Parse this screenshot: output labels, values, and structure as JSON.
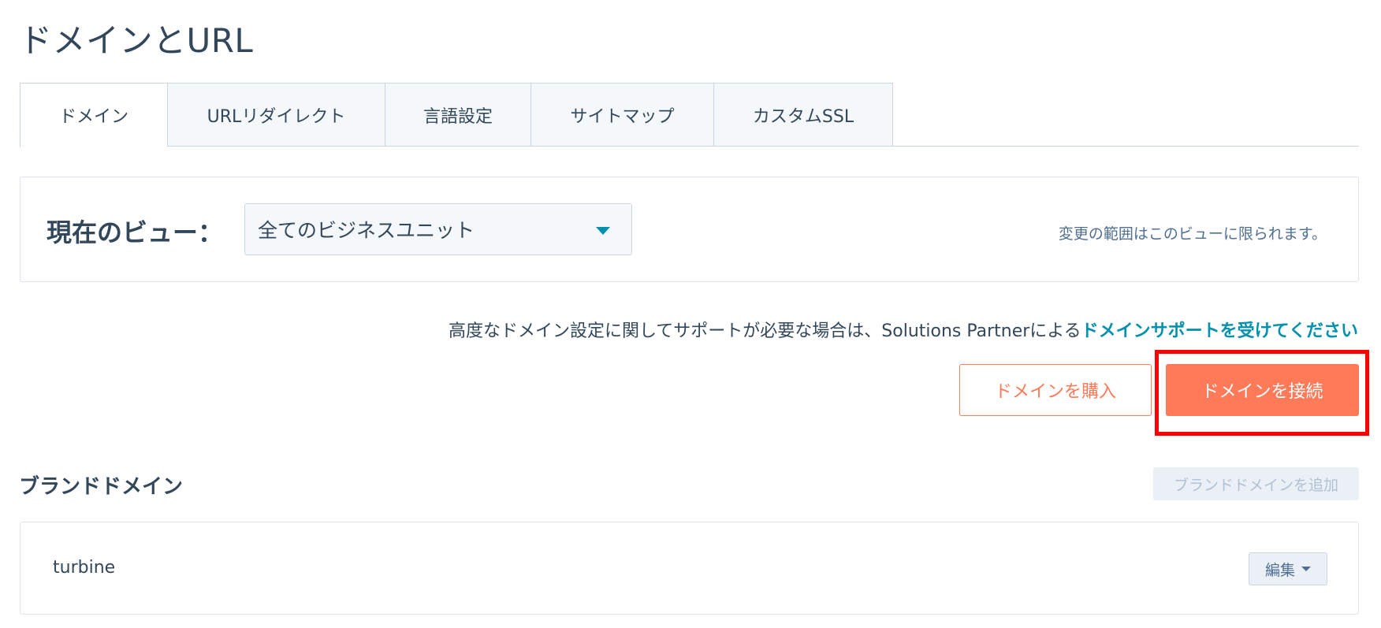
{
  "page": {
    "title": "ドメインとURL"
  },
  "tabs": [
    {
      "label": "ドメイン",
      "active": true
    },
    {
      "label": "URLリダイレクト",
      "active": false
    },
    {
      "label": "言語設定",
      "active": false
    },
    {
      "label": "サイトマップ",
      "active": false
    },
    {
      "label": "カスタムSSL",
      "active": false
    }
  ],
  "view": {
    "label": "現在のビュー：",
    "selected": "全てのビジネスユニット",
    "note": "変更の範囲はこのビューに限られます。"
  },
  "support": {
    "text": "高度なドメイン設定に関してサポートが必要な場合は、Solutions Partnerによる",
    "link": "ドメインサポートを受けてください"
  },
  "actions": {
    "buy_label": "ドメインを購入",
    "connect_label": "ドメインを接続"
  },
  "brand_domain": {
    "title": "ブランドドメイン",
    "add_label": "ブランドドメインを追加",
    "items": [
      {
        "name": "turbine",
        "edit_label": "編集"
      }
    ]
  },
  "colors": {
    "accent": "#ff7a59",
    "link": "#0091ae",
    "text": "#33475b",
    "highlight": "#ff0000"
  }
}
